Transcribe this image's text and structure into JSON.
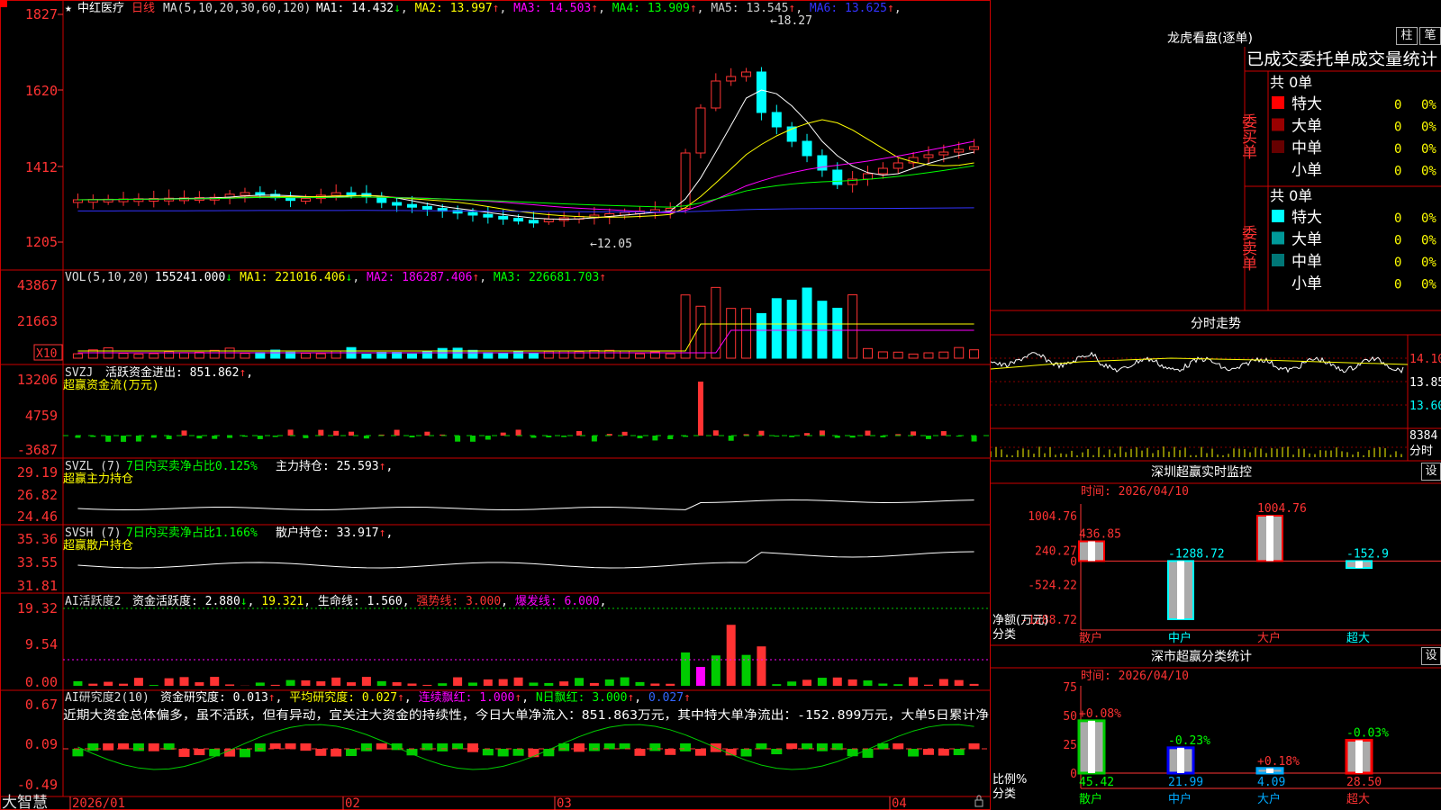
{
  "stock": {
    "star": "★",
    "name": "中红医疗",
    "period": "日线"
  },
  "panels": {
    "main": {
      "ma_label": "MA(5,10,20,30,60,120)",
      "ma": [
        {
          "label": "MA1: 14.432",
          "arrow": "↓",
          "color": "#ffffff"
        },
        {
          "label": "MA2: 13.997",
          "arrow": "↑",
          "color": "#ffff00"
        },
        {
          "label": "MA3: 14.503",
          "arrow": "↑",
          "color": "#ff00ff"
        },
        {
          "label": "MA4: 13.909",
          "arrow": "↑",
          "color": "#00ff00"
        },
        {
          "label": "MA5: 13.545",
          "arrow": "↑",
          "color": "#cccccc"
        },
        {
          "label": "MA6: 13.625",
          "arrow": "↑",
          "color": "#3333ff"
        }
      ],
      "y_ticks": [
        "1827",
        "1620",
        "1412",
        "1205"
      ],
      "high_mark": "18.27",
      "low_mark": "12.05"
    },
    "vol": {
      "title": "VOL(5,10,20)",
      "value": "155241.000",
      "value_arrow": "↓",
      "ma1": "MA1: 221016.406",
      "ma1_arrow": "↓",
      "ma2": "MA2: 186287.406",
      "ma2_arrow": "↑",
      "ma3": "MA3: 226681.703",
      "ma3_arrow": "↑",
      "y_ticks": [
        "43867",
        "21663"
      ],
      "unit": "X10"
    },
    "svzj": {
      "title": "SVZJ",
      "label": "活跃资金进出: 851.862",
      "arrow": "↑",
      "sub": "超赢资金流(万元)",
      "y_ticks": [
        "13206",
        "4759",
        "-3687"
      ]
    },
    "svzl": {
      "title": "SVZL (7)",
      "label": "7日内买卖净占比0.125%",
      "label2": "主力持仓: 25.593",
      "arrow": "↑",
      "sub": "超赢主力持仓",
      "y_ticks": [
        "29.19",
        "26.82",
        "24.46"
      ]
    },
    "svsh": {
      "title": "SVSH (7)",
      "label": "7日内买卖净占比1.166%",
      "label2": "散户持仓: 33.917",
      "arrow": "↑",
      "sub": "超赢散户持仓",
      "y_ticks": [
        "35.36",
        "33.55",
        "31.81"
      ]
    },
    "ai1": {
      "title": "AI活跃度2",
      "label": "资金活跃度: 2.880",
      "arrow": "↓",
      "v2": "19.321",
      "life": "生命线: 1.560",
      "strong": "强势线: 3.000",
      "burst": "爆发线: 6.000",
      "y_ticks": [
        "19.32",
        "9.54",
        "0.00"
      ]
    },
    "ai2": {
      "title": "AI研究度2(10)",
      "label": "资金研究度: 0.013",
      "arrow": "↑",
      "avg": "平均研究度: 0.027",
      "avg_arrow": "↑",
      "streak": "连续飘红: 1.000",
      "streak_arrow": "↑",
      "nred": "N日飘红: 3.000",
      "nred_arrow": "↑",
      "last": "0.027",
      "last_arrow": "↑",
      "comment": "近期大资金总体偏多，虽不活跃，但有异动，宜关注大资金的持续性，今日大单净流入：851.863万元，其中特大单净流出：-152.899万元，大单5日累计净",
      "y_ticks": [
        "0.67",
        "0.09",
        "-0.49"
      ]
    }
  },
  "x_axis": {
    "labels": [
      "2026/01",
      "02",
      "03",
      "04"
    ]
  },
  "bottom_logo": "大智慧",
  "dragon": {
    "title": "龙虎看盘(逐单)",
    "btn1": "柱",
    "btn2": "笔",
    "header": "已成交委托单成交量统计",
    "buy_group": "委买单",
    "sell_group": "委卖单",
    "buy_total": "共 0单",
    "sell_total": "共 0单",
    "buy_rows": [
      {
        "label": "特大",
        "value": "0",
        "pct": "0%",
        "color": "#ff0000"
      },
      {
        "label": "大单",
        "value": "0",
        "pct": "0%",
        "color": "#990000"
      },
      {
        "label": "中单",
        "value": "0",
        "pct": "0%",
        "color": "#660000"
      },
      {
        "label": "小单",
        "value": "0",
        "pct": "0%",
        "color": ""
      }
    ],
    "sell_rows": [
      {
        "label": "特大",
        "value": "0",
        "pct": "0%",
        "color": "#00ffff"
      },
      {
        "label": "大单",
        "value": "0",
        "pct": "0%",
        "color": "#009999"
      },
      {
        "label": "中单",
        "value": "0",
        "pct": "0%",
        "color": "#007777"
      },
      {
        "label": "小单",
        "value": "0",
        "pct": "0%",
        "color": ""
      }
    ]
  },
  "intraday": {
    "title": "分时走势",
    "prices": [
      "14.10",
      "13.85",
      "13.60"
    ],
    "volume": "8384",
    "volume_unit": "分时"
  },
  "shenzhen_monitor": {
    "title": "深圳超赢实时监控",
    "set_btn": "设",
    "time": "时间: 2026/04/10",
    "y_ticks": [
      "1004.76",
      "240.27",
      "0",
      "-524.22",
      "-1288.72"
    ],
    "y_title": "净额(万元)",
    "x_title": "分类",
    "bars": [
      {
        "label": "散户",
        "value": 436.85,
        "text": "436.85",
        "color": "#ff0000"
      },
      {
        "label": "中户",
        "value": -1288.72,
        "text": "-1288.72",
        "color": "#00ffff"
      },
      {
        "label": "大户",
        "value": 1004.76,
        "text": "1004.76",
        "color": "#ff0000"
      },
      {
        "label": "超大",
        "value": -152.9,
        "text": "-152.9",
        "color": "#00ffff"
      }
    ]
  },
  "shenzhen_stats": {
    "title": "深市超赢分类统计",
    "set_btn": "设",
    "time": "时间: 2026/04/10",
    "y_ticks": [
      "75",
      "50",
      "25",
      "0"
    ],
    "y_title": "比例%",
    "x_title": "分类",
    "bars": [
      {
        "label": "散户",
        "value": 45.42,
        "text": "45.42",
        "delta": "+0.08%",
        "color": "#00cc00",
        "delta_color": "#ff3333"
      },
      {
        "label": "中户",
        "value": 21.99,
        "text": "21.99",
        "delta": "-0.23%",
        "color": "#0000ff",
        "delta_color": "#00ff00"
      },
      {
        "label": "大户",
        "value": 4.09,
        "text": "4.09",
        "delta": "+0.18%",
        "color": "#00aaff",
        "delta_color": "#ff3333"
      },
      {
        "label": "超大",
        "value": 28.5,
        "text": "28.50",
        "delta": "-0.03%",
        "color": "#ff0000",
        "delta_color": "#00ff00"
      }
    ]
  }
}
